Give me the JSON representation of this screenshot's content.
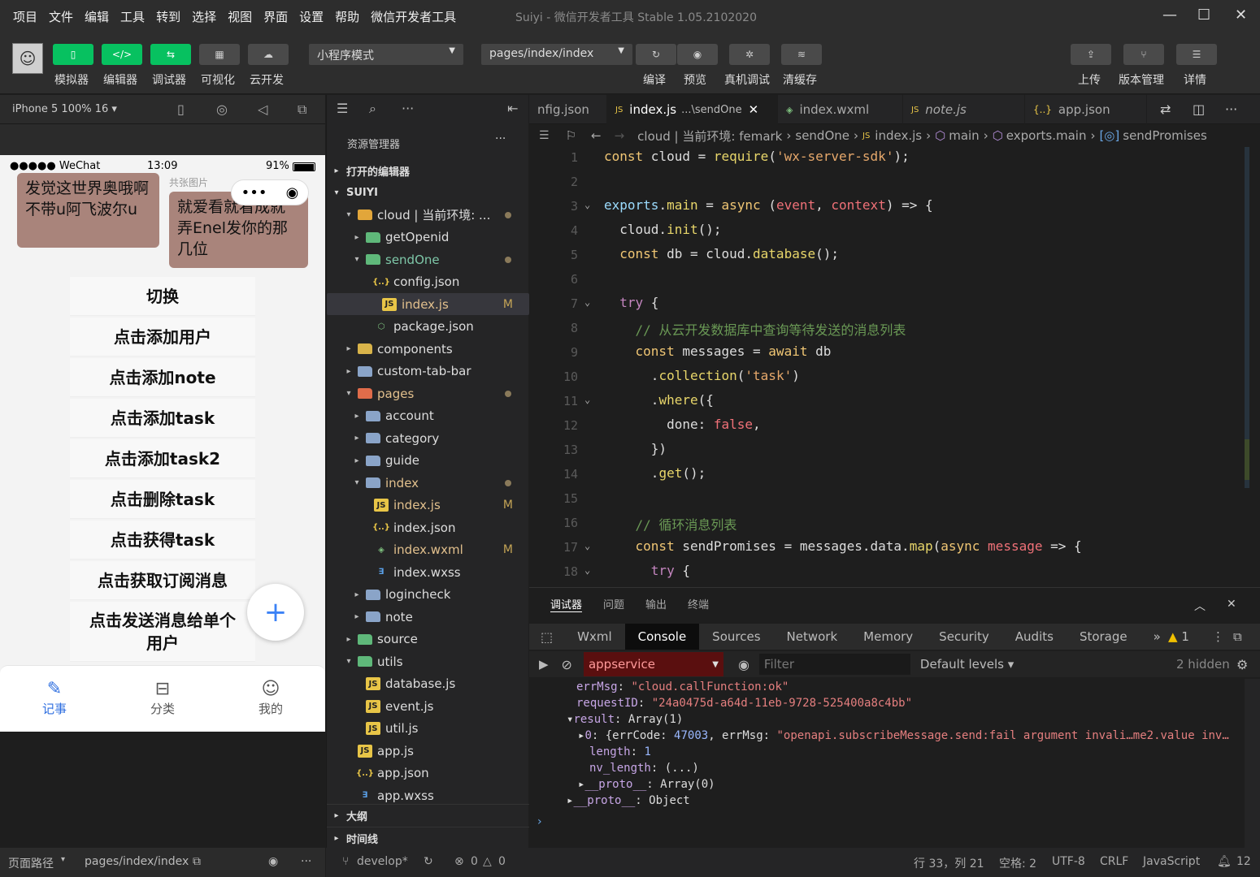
{
  "menu": {
    "items": [
      "项目",
      "文件",
      "编辑",
      "工具",
      "转到",
      "选择",
      "视图",
      "界面",
      "设置",
      "帮助",
      "微信开发者工具"
    ],
    "title": "Suiyi - 微信开发者工具 Stable 1.05.2102020"
  },
  "toolbar": {
    "left": [
      "模拟器",
      "编辑器",
      "调试器",
      "可视化",
      "云开发"
    ],
    "mode": "小程序模式",
    "page": "pages/index/index",
    "right1": [
      "编译",
      "预览",
      "真机调试",
      "清缓存"
    ],
    "right2": [
      "上传",
      "版本管理",
      "详情"
    ]
  },
  "sim": {
    "device": "iPhone 5 100% 16 ▾",
    "status": {
      "carrier": "●●●●● WeChat",
      "time": "13:09",
      "battery": "91%"
    },
    "tag_top": "共张图片",
    "bubble1": "发觉这世界奥哦啊不带u阿飞波尔u",
    "bubble2": "就爱看就看成就弄Enel发你的那几位",
    "tag2": "共张图片",
    "buttons": [
      "切换",
      "点击添加用户",
      "点击添加note",
      "点击添加task",
      "点击添加task2",
      "点击删除task",
      "点击获得task",
      "点击获取订阅消息",
      "点击发送消息给单个用户"
    ],
    "tabs": [
      "记事",
      "分类",
      "我的"
    ],
    "footer": {
      "path_label": "页面路径",
      "path": "pages/index/index"
    }
  },
  "explorer": {
    "title": "资源管理器",
    "open": "打开的编辑器",
    "root": "SUIYI",
    "items": [
      {
        "name": "cloud | 当前环境: ...",
        "indent": 1,
        "type": "folder-cloud",
        "chev": "▾",
        "mark": "dot"
      },
      {
        "name": "getOpenid",
        "indent": 2,
        "type": "folder-green",
        "chev": "▸"
      },
      {
        "name": "sendOne",
        "indent": 2,
        "type": "folder-green",
        "chev": "▾",
        "mark": "dot",
        "color": "#7ec7a8"
      },
      {
        "name": "config.json",
        "indent": 3,
        "type": "json"
      },
      {
        "name": "index.js",
        "indent": 3,
        "type": "js",
        "mark": "M",
        "sel": true,
        "color": "#e2c08d"
      },
      {
        "name": "package.json",
        "indent": 3,
        "type": "pkg"
      },
      {
        "name": "components",
        "indent": 1,
        "type": "folder-y",
        "chev": "▸"
      },
      {
        "name": "custom-tab-bar",
        "indent": 1,
        "type": "folder",
        "chev": "▸"
      },
      {
        "name": "pages",
        "indent": 1,
        "type": "folder-r",
        "chev": "▾",
        "mark": "dot",
        "color": "#e2c08d"
      },
      {
        "name": "account",
        "indent": 2,
        "type": "folder",
        "chev": "▸"
      },
      {
        "name": "category",
        "indent": 2,
        "type": "folder",
        "chev": "▸"
      },
      {
        "name": "guide",
        "indent": 2,
        "type": "folder",
        "chev": "▸"
      },
      {
        "name": "index",
        "indent": 2,
        "type": "folder",
        "chev": "▾",
        "mark": "dot",
        "color": "#e2c08d"
      },
      {
        "name": "index.js",
        "indent": 3,
        "type": "js",
        "mark": "M",
        "color": "#e2c08d"
      },
      {
        "name": "index.json",
        "indent": 3,
        "type": "json"
      },
      {
        "name": "index.wxml",
        "indent": 3,
        "type": "wxml",
        "mark": "M",
        "color": "#e2c08d"
      },
      {
        "name": "index.wxss",
        "indent": 3,
        "type": "wxss"
      },
      {
        "name": "logincheck",
        "indent": 2,
        "type": "folder",
        "chev": "▸"
      },
      {
        "name": "note",
        "indent": 2,
        "type": "folder",
        "chev": "▸"
      },
      {
        "name": "source",
        "indent": 1,
        "type": "folder-green",
        "chev": "▸"
      },
      {
        "name": "utils",
        "indent": 1,
        "type": "folder-green",
        "chev": "▾"
      },
      {
        "name": "database.js",
        "indent": 2,
        "type": "js"
      },
      {
        "name": "event.js",
        "indent": 2,
        "type": "js"
      },
      {
        "name": "util.js",
        "indent": 2,
        "type": "js"
      },
      {
        "name": "app.js",
        "indent": 1,
        "type": "js"
      },
      {
        "name": "app.json",
        "indent": 1,
        "type": "json"
      },
      {
        "name": "app.wxss",
        "indent": 1,
        "type": "wxss"
      }
    ],
    "outline": "大纲",
    "timeline": "时间线"
  },
  "tabs": [
    "nfig.json",
    "index.js",
    "...\\sendOne",
    "index.wxml",
    "note.js",
    "app.json"
  ],
  "crumb": [
    "cloud | 当前环境: femark",
    "sendOne",
    "index.js",
    "main",
    "exports.main",
    "sendPromises"
  ],
  "code": [
    {
      "n": "1",
      "h": "<span class='kw'>const</span> cloud = <span class='fn'>require</span>(<span class='st'>'wx-server-sdk'</span>);"
    },
    {
      "n": "2",
      "h": ""
    },
    {
      "n": "3",
      "h": "<span class='pr'>exports</span>.<span class='fn'>main</span> = <span class='kw'>async</span> (<span class='bl'>event</span>, <span class='bl'>context</span>) => {"
    },
    {
      "n": "4",
      "h": "  cloud.<span class='fn'>init</span>();"
    },
    {
      "n": "5",
      "h": "  <span class='kw'>const</span> db = cloud.<span class='fn'>database</span>();"
    },
    {
      "n": "6",
      "h": ""
    },
    {
      "n": "7",
      "h": "  <span class='pu'>try</span> {"
    },
    {
      "n": "8",
      "h": "    <span class='cm'>// 从云开发数据库中查询等待发送的消息列表</span>"
    },
    {
      "n": "9",
      "h": "    <span class='kw'>const</span> messages = <span class='kw'>await</span> db"
    },
    {
      "n": "10",
      "h": "      .<span class='fn'>collection</span>(<span class='st'>'task'</span>)"
    },
    {
      "n": "11",
      "h": "      .<span class='fn'>where</span>({"
    },
    {
      "n": "12",
      "h": "        done: <span class='bl'>false</span>,"
    },
    {
      "n": "13",
      "h": "      })"
    },
    {
      "n": "14",
      "h": "      .<span class='fn'>get</span>();"
    },
    {
      "n": "15",
      "h": ""
    },
    {
      "n": "16",
      "h": "    <span class='cm'>// 循环消息列表</span>"
    },
    {
      "n": "17",
      "h": "    <span class='kw'>const</span> sendPromises = messages.data.<span class='fn'>map</span>(<span class='kw'>async</span> <span class='bl'>message</span> => {"
    },
    {
      "n": "18",
      "h": "      <span class='pu'>try</span> {"
    }
  ],
  "panel": {
    "tabs": [
      "调试器",
      "问题",
      "输出",
      "终端"
    ],
    "devtabs": [
      "Wxml",
      "Console",
      "Sources",
      "Network",
      "Memory",
      "Security",
      "Audits",
      "Storage"
    ],
    "warn": "1",
    "context": "appservice",
    "filter": "Filter",
    "levels": "Default levels",
    "hidden": "2 hidden"
  },
  "console": [
    {
      "h": "<span class='ck'>errMsg</span>: <span class='cs'>\"cloud.callFunction:ok\"</span>",
      "x": 58
    },
    {
      "h": "<span class='ck'>requestID</span>: <span class='cs'>\"24a0475d-a64d-11eb-9728-525400a8c4bb\"</span>",
      "x": 58
    },
    {
      "h": "▾<span class='ck'>result</span>: Array(1)",
      "x": 46
    },
    {
      "h": "▸<span class='ck'>0</span>: {errCode: <span class='cn'>47003</span>, errMsg: <span class='cs'>\"openapi.subscribeMessage.send:fail argument invali…me2.value inv…</span>",
      "x": 60
    },
    {
      "h": "<span class='ck'>length</span>: <span class='cn'>1</span>",
      "x": 74
    },
    {
      "h": "<span class='ck'>nv_length</span>: (...)",
      "x": 74
    },
    {
      "h": "▸<span class='ck'>__proto__</span>: Array(0)",
      "x": 60
    },
    {
      "h": "▸<span class='ck'>__proto__</span>: Object",
      "x": 46
    }
  ],
  "status": {
    "branch": "develop*",
    "errors": "0",
    "warnings": "0",
    "pos": "行 33，列 21",
    "space": "空格: 2",
    "enc": "UTF-8",
    "eol": "CRLF",
    "lang": "JavaScript",
    "bell": "12"
  }
}
